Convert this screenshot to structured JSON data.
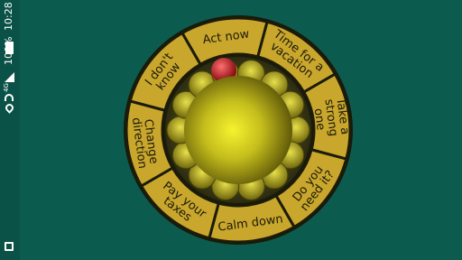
{
  "status_bar": {
    "time": "10:28",
    "battery": "100%",
    "network": "4G"
  },
  "wheel": {
    "segments": [
      {
        "label_lines": [
          "Act now"
        ]
      },
      {
        "label_lines": [
          "Time for a",
          "vacation"
        ]
      },
      {
        "label_lines": [
          "Take a",
          "strong",
          "one"
        ]
      },
      {
        "label_lines": [
          "Do you",
          "need it?"
        ]
      },
      {
        "label_lines": [
          "Calm down"
        ]
      },
      {
        "label_lines": [
          "Pay your",
          "taxes"
        ]
      },
      {
        "label_lines": [
          "Change",
          "direction"
        ]
      },
      {
        "label_lines": [
          "I don't",
          "know"
        ]
      }
    ],
    "colors": {
      "segment": "#c9a62c",
      "segment_dark": "#8a6d12",
      "divider": "#1b1b0a",
      "text": "#1b1a0d",
      "center_light": "#f4ef2c",
      "center_dark": "#5c5508",
      "marker": "#b81a1e"
    }
  },
  "icons": {
    "bottom_left": "screenshot-icon"
  }
}
